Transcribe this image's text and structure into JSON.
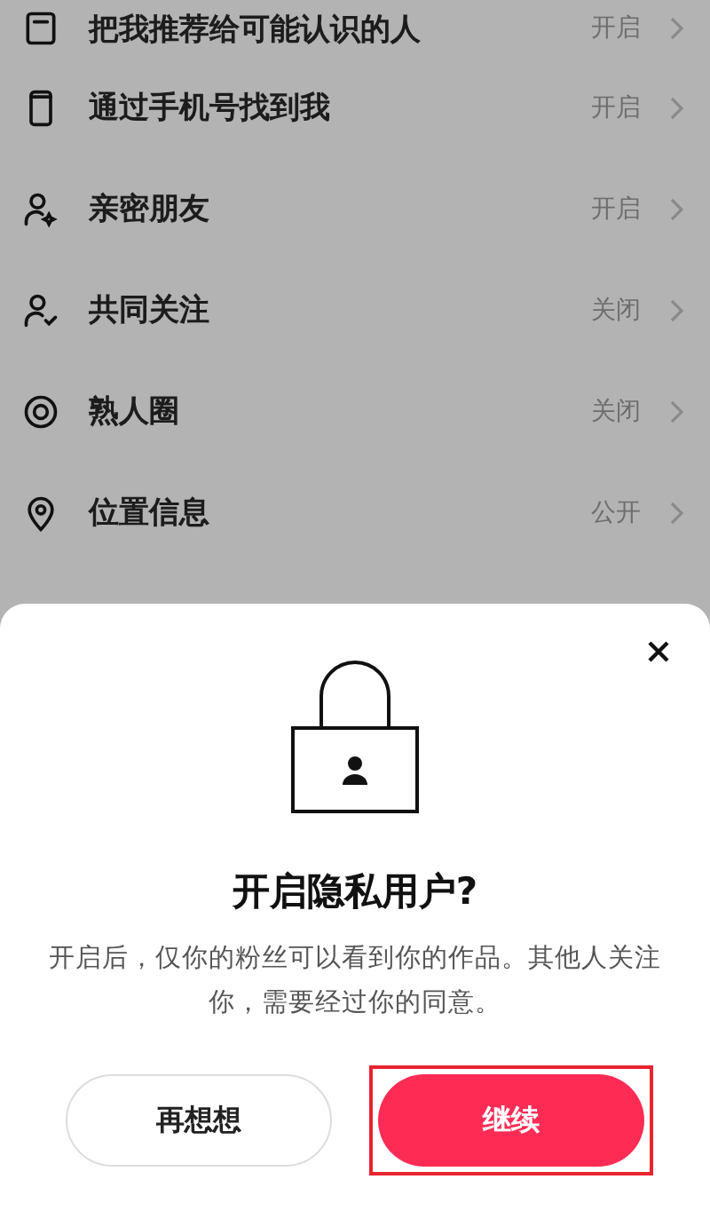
{
  "settings": [
    {
      "kind": "contacts",
      "label": "把我推荐给可能认识的人",
      "value": "开启"
    },
    {
      "kind": "phone",
      "label": "通过手机号找到我",
      "value": "开启"
    },
    {
      "kind": "person-star",
      "label": "亲密朋友",
      "value": "开启"
    },
    {
      "kind": "person-check",
      "label": "共同关注",
      "value": "关闭"
    },
    {
      "kind": "target",
      "label": "熟人圈",
      "value": "关闭"
    },
    {
      "kind": "pin",
      "label": "位置信息",
      "value": "公开"
    }
  ],
  "dialog": {
    "title": "开启隐私用户?",
    "message": "开启后，仅你的粉丝可以看到你的作品。其他人关注你，需要经过你的同意。",
    "buttons": [
      {
        "label": "再想想",
        "kind": "secondary",
        "highlighted": false
      },
      {
        "label": "继续",
        "kind": "primary",
        "highlighted": true
      }
    ]
  }
}
